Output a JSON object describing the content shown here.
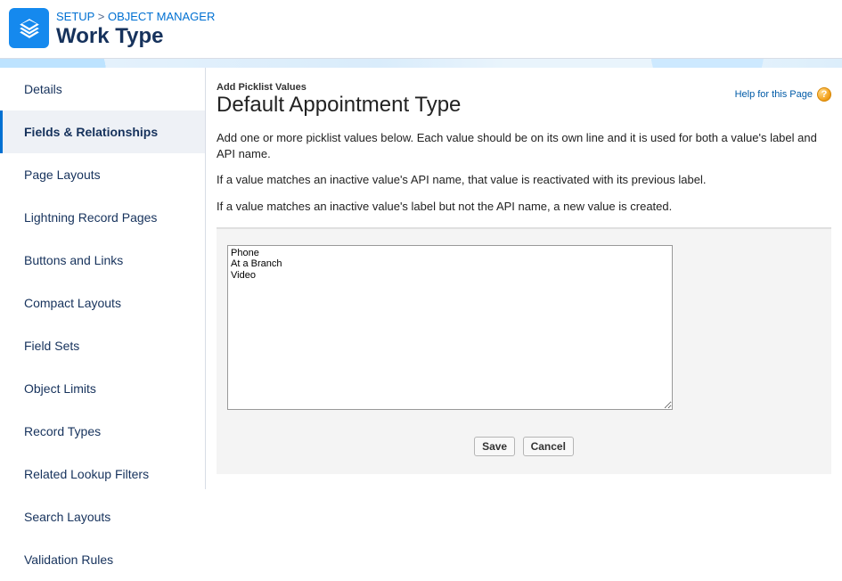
{
  "breadcrumb": {
    "item1": "Setup",
    "item2": "Object Manager",
    "sep": ">"
  },
  "page_title": "Work Type",
  "sidebar": {
    "items": [
      {
        "label": "Details"
      },
      {
        "label": "Fields & Relationships"
      },
      {
        "label": "Page Layouts"
      },
      {
        "label": "Lightning Record Pages"
      },
      {
        "label": "Buttons and Links"
      },
      {
        "label": "Compact Layouts"
      },
      {
        "label": "Field Sets"
      },
      {
        "label": "Object Limits"
      },
      {
        "label": "Record Types"
      },
      {
        "label": "Related Lookup Filters"
      },
      {
        "label": "Search Layouts"
      },
      {
        "label": "Validation Rules"
      }
    ]
  },
  "subheader": "Add Picklist Values",
  "heading": "Default Appointment Type",
  "help_link": "Help for this Page",
  "help_glyph": "?",
  "descriptions": {
    "p1": "Add one or more picklist values below. Each value should be on its own line and it is used for both a value's label and API name.",
    "p2": "If a value matches an inactive value's API name, that value is reactivated with its previous label.",
    "p3": "If a value matches an inactive value's label but not the API name, a new value is created."
  },
  "textarea_value": "Phone\nAt a Branch\nVideo",
  "buttons": {
    "save": "Save",
    "cancel": "Cancel"
  }
}
